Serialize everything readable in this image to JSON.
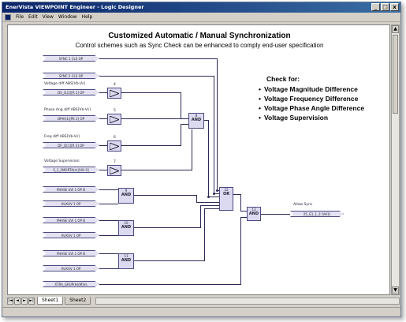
{
  "window": {
    "title": "EnerVista VIEWPOINT Engineer - Logic Designer",
    "controls": [
      "_",
      "□",
      "x"
    ]
  },
  "menu": {
    "items": [
      "File",
      "Edit",
      "View",
      "Window",
      "Help"
    ]
  },
  "diagram": {
    "title": "Customized Automatic / Manual Synchronization",
    "subtitle": "Control schemes such as Sync Check  can be enhanced to comply end-user specification",
    "check": {
      "heading": "Check for:",
      "items": [
        "Voltage Magnitude Difference",
        "Voltage Frequency Difference",
        "Voltage Phase Angle Difference",
        "Voltage Supervision"
      ]
    },
    "inputs": {
      "sync1": "SYNC 1 CLS OP",
      "sync2": "SYNC 2 CLS OP",
      "volt": "DV_I1[1][R 1] OP",
      "phase": "DPHI(1)[PE 2] OP",
      "freq": "DF_I1[1][R 3] OP",
      "sup": "S_1_2MORTA(m)[VH 0]",
      "ph1": "PHASE UVI 1 OP B",
      "aux1": "AUXUV 1 OP",
      "ph2": "PHASE UVI 1 OP B",
      "aux2": "AUXUV 1 OP",
      "ph3": "PHASE UVI 1 OP B",
      "aux3": "AUXUV 1 OP",
      "xtra": "XTRA_GRUP(H)(M)Vs"
    },
    "labels": {
      "volt": "Voltage diff ABS[Vb-Vs]",
      "phase": "Phase Ang diff ABS[Vb-Vs]",
      "freq": "Freq diff ABS[Vb-Vs]",
      "sup": "Voltage Supervision",
      "allow": "Allow Sync"
    },
    "gates": {
      "and1": "AND",
      "and2": "AND",
      "and3": "AND",
      "and4": "AND",
      "or1": "OR",
      "and5": "AND",
      "n_and1": "8",
      "n_and2": "9",
      "n_and3": "10",
      "n_and4": "11",
      "n_or1": "12",
      "n_and5": "13",
      "n_t1": "4",
      "n_t2": "5",
      "n_t3": "6",
      "n_t4": "7"
    },
    "output": "25_G1_1_3 (VH1)"
  },
  "tabs": [
    "Sheet1",
    "Sheet2"
  ]
}
